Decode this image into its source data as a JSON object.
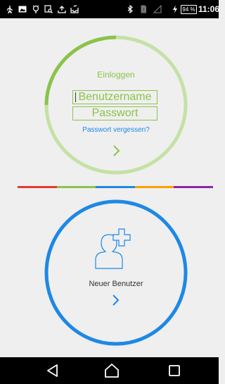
{
  "status_bar": {
    "icons": [
      "usb-icon",
      "image-icon",
      "bulb-icon",
      "clipboard-search-icon",
      "upload-icon",
      "inbox-icon",
      "bluetooth-icon",
      "sim-icon",
      "signal-icon",
      "charging-icon"
    ],
    "battery": "94 %",
    "time": "11:06"
  },
  "login": {
    "title": "Einloggen",
    "username_placeholder": "Benutzername",
    "password_placeholder": "Passwort",
    "forgot": "Passwort vergessen?",
    "arrow_icon": "chevron-right-icon",
    "ring_color": "#8bc34a",
    "ring_track_color": "#c5e1a5",
    "progress": 0.25
  },
  "divider": {
    "colors": [
      "#e53935",
      "#8bc34a",
      "#1e88e5",
      "#ffa000",
      "#8e24aa"
    ]
  },
  "new_user": {
    "label": "Neuer Benutzer",
    "icon": "add-user-icon",
    "arrow_icon": "chevron-right-icon",
    "ring_color": "#1e88e5"
  },
  "nav_bar": {
    "buttons": [
      "back-icon",
      "home-icon",
      "recents-icon"
    ]
  }
}
